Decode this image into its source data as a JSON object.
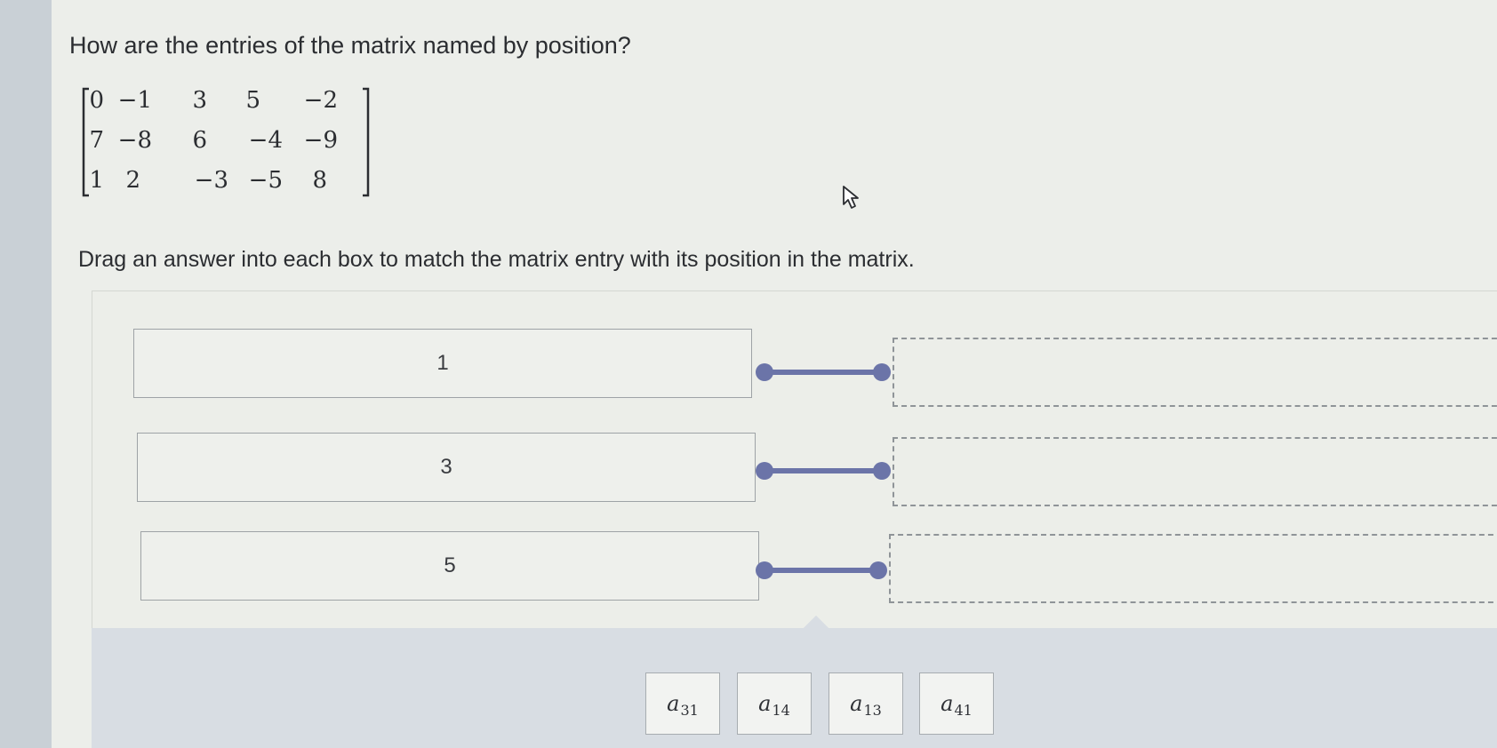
{
  "question": "How are the entries of the matrix named by position?",
  "matrix": {
    "rows": [
      [
        "0",
        "−1",
        "3",
        "5",
        "−2"
      ],
      [
        "7",
        "−8",
        "6",
        "−4",
        "−9"
      ],
      [
        "1",
        "2",
        "−3",
        "−5",
        "8"
      ]
    ]
  },
  "instruction": "Drag an answer into each box to match the matrix entry with its position in the matrix.",
  "matches": [
    {
      "entry": "1",
      "answer": ""
    },
    {
      "entry": "3",
      "answer": ""
    },
    {
      "entry": "5",
      "answer": ""
    }
  ],
  "answer_bank": [
    {
      "base": "a",
      "sub": "31"
    },
    {
      "base": "a",
      "sub": "14"
    },
    {
      "base": "a",
      "sub": "13"
    },
    {
      "base": "a",
      "sub": "41"
    }
  ],
  "colors": {
    "connector": "#6b74a8",
    "bank_background": "#d8dde3",
    "page_background": "#eceeea"
  },
  "icons": {
    "cursor": "arrow-cursor-icon"
  }
}
